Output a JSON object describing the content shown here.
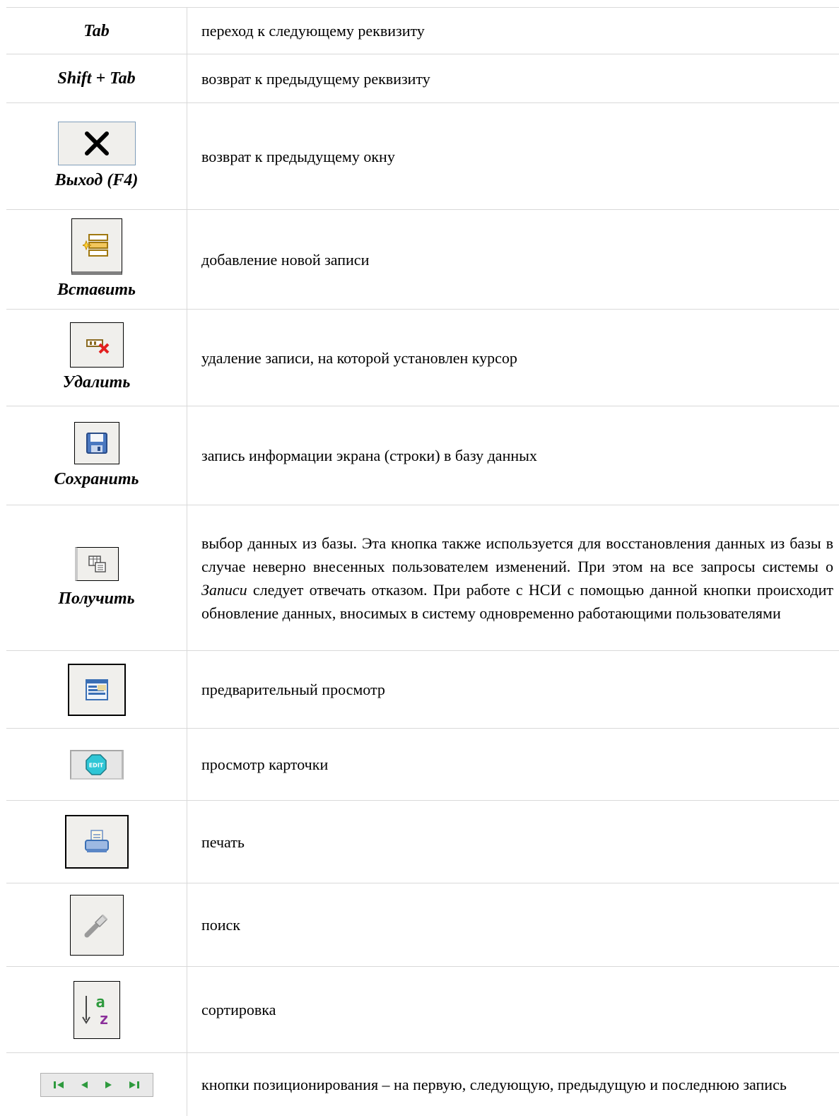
{
  "rows": [
    {
      "label": "Tab",
      "description": "переход к следующему реквизиту"
    },
    {
      "label": "Shift + Tab",
      "description": "возврат к предыдущему реквизиту"
    },
    {
      "label": "Выход (F4)",
      "icon": "close-x-icon",
      "description": "возврат к предыдущему окну"
    },
    {
      "label": "Вставить",
      "icon": "insert-record-icon",
      "description": "добавление новой записи"
    },
    {
      "label": "Удалить",
      "icon": "delete-record-icon",
      "description": "удаление записи, на которой установлен курсор"
    },
    {
      "label": "Сохранить",
      "icon": "floppy-save-icon",
      "description": "запись информации экрана (строки) в базу данных"
    },
    {
      "label": "Получить",
      "icon": "retrieve-data-icon",
      "description_parts": [
        "выбор данных из базы. Эта кнопка также используется для восстановления данных из базы в случае неверно внесенных пользователем изменений. При этом на все запросы системы о ",
        "Записи",
        " следует отвечать отказом. При работе с НСИ с помощью данной кнопки происходит обновление данных, вносимых в систему одновременно работающими пользователями"
      ]
    },
    {
      "icon": "preview-icon",
      "description": "предварительный просмотр"
    },
    {
      "icon": "edit-card-icon",
      "icon_text": "EDIT",
      "description": "просмотр карточки"
    },
    {
      "icon": "printer-icon",
      "description": "печать"
    },
    {
      "icon": "search-torch-icon",
      "description": "поиск"
    },
    {
      "icon": "sort-az-icon",
      "icon_text_a": "a",
      "icon_text_z": "z",
      "description": "сортировка"
    },
    {
      "icon": "navigation-buttons-icon",
      "description": "кнопки позиционирования – на первую, следующую,  предыдущую и последнюю запись"
    }
  ],
  "colors": {
    "grid": "#d9d9d9",
    "button_bg": "#f0efec",
    "icon_blue": "#3a6fb5",
    "icon_green": "#2e9a3e",
    "icon_purple": "#8b2f9a",
    "icon_cyan": "#2fc6d6"
  }
}
